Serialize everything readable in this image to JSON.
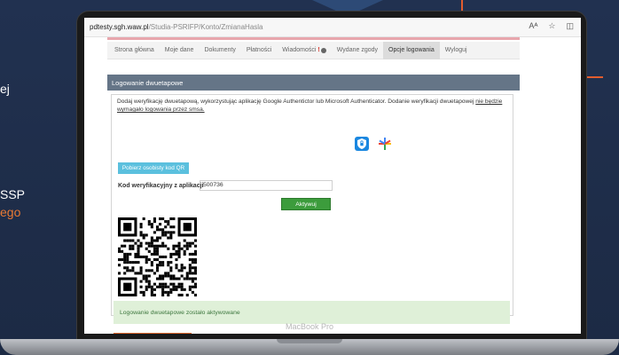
{
  "side": {
    "line1": "ej",
    "line2": "SSP",
    "line3": "ego"
  },
  "browser": {
    "host": "pdtesty.sgh.waw.pl",
    "path": "/Studia-PSRIFP/Konto/ZmianaHasla",
    "reader_label": "Aᴬ"
  },
  "nav": {
    "items": [
      {
        "label": "Strona główna"
      },
      {
        "label": "Moje dane"
      },
      {
        "label": "Dokumenty"
      },
      {
        "label": "Płatności"
      },
      {
        "label": "Wiadomości"
      },
      {
        "label": "Wydane zgody"
      },
      {
        "label": "Opcje logowania"
      },
      {
        "label": "Wyloguj"
      }
    ],
    "messages_badge": "!",
    "active": "Opcje logowania"
  },
  "panel": {
    "title": "Logowanie dwuetapowe",
    "description_before": "Dodaj weryfikację dwuetapową, wykorzystując aplikację Google Authentictor lub Microsoft Authenticator. Dodanie weryfikacji dwuetapowej ",
    "description_link": "nie będzie wymagało logowania przez smsa.",
    "qr_button": "Pobierz osobisty kod QR",
    "code_label": "Kod weryfikacyjny z aplikacji",
    "code_value": "500736",
    "activate_button": "Aktywuj",
    "success_message": "Logowanie dwuetapowe zostało aktywowane"
  },
  "laptop": {
    "model_label": "MacBook Pro"
  },
  "colors": {
    "background": "#1f2e49",
    "accent_orange": "#e25d2e",
    "panel_header": "#657587",
    "activate_green": "#3c9c3c",
    "qr_button": "#5bc0de",
    "success_bg": "#dff0d8"
  },
  "icons": {
    "app1": "microsoft-authenticator-icon",
    "app2": "google-authenticator-icon"
  }
}
